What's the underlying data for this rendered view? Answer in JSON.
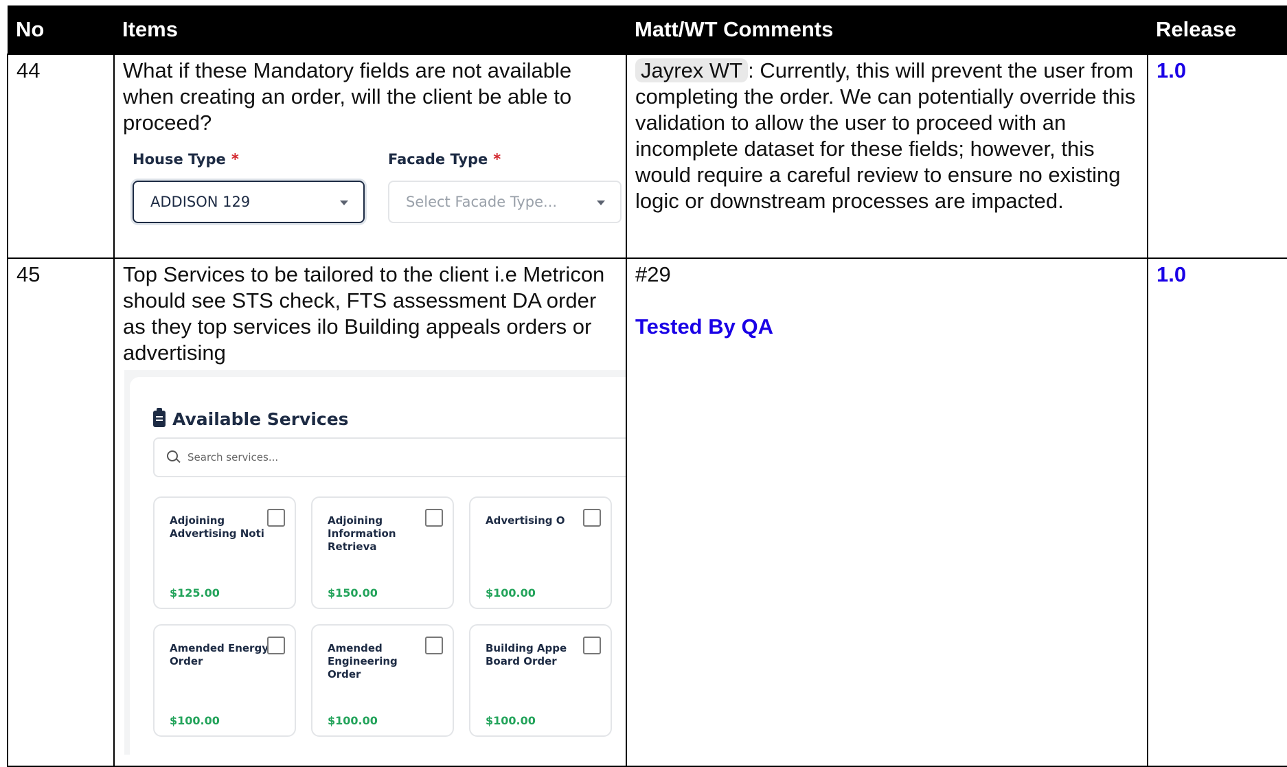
{
  "headers": {
    "no": "No",
    "items": "Items",
    "comments": "Matt/WT Comments",
    "release": "Release"
  },
  "rows": [
    {
      "no": "44",
      "item_text": "What if these Mandatory fields are not available when creating an order, will the client be able to proceed?",
      "fields": {
        "house_type_label": "House Type",
        "facade_type_label": "Facade Type",
        "required_mark": "*",
        "house_type_value": "ADDISON 129",
        "facade_type_placeholder": "Select Facade Type..."
      },
      "mention": "Jayrex WT",
      "comment": ": Currently, this will prevent the user from completing the order. We can potentially override this validation to allow the user to proceed with an incomplete dataset for these fields; however, this would require a careful review to ensure no existing logic or downstream processes are impacted.",
      "release": "1.0"
    },
    {
      "no": "45",
      "item_text": "Top Services to be tailored to the client i.e Metricon should see STS check, FTS assessment DA order as they top services ilo Building appeals orders or advertising",
      "services": {
        "title": "Available Services",
        "search_placeholder": "Search services...",
        "cards": [
          {
            "name": "Adjoining\nAdvertising Noti",
            "price": "$125.00"
          },
          {
            "name": "Adjoining\nInformation Retrieva",
            "price": "$150.00"
          },
          {
            "name": "Advertising O",
            "price": "$100.00"
          },
          {
            "name": "Amended Energy\nOrder",
            "price": "$100.00"
          },
          {
            "name": "Amended\nEngineering Order",
            "price": "$100.00"
          },
          {
            "name": "Building Appe\nBoard Order",
            "price": "$100.00"
          }
        ]
      },
      "comment_ref": "#29",
      "tested_label": "Tested By QA",
      "release": "1.0"
    }
  ]
}
